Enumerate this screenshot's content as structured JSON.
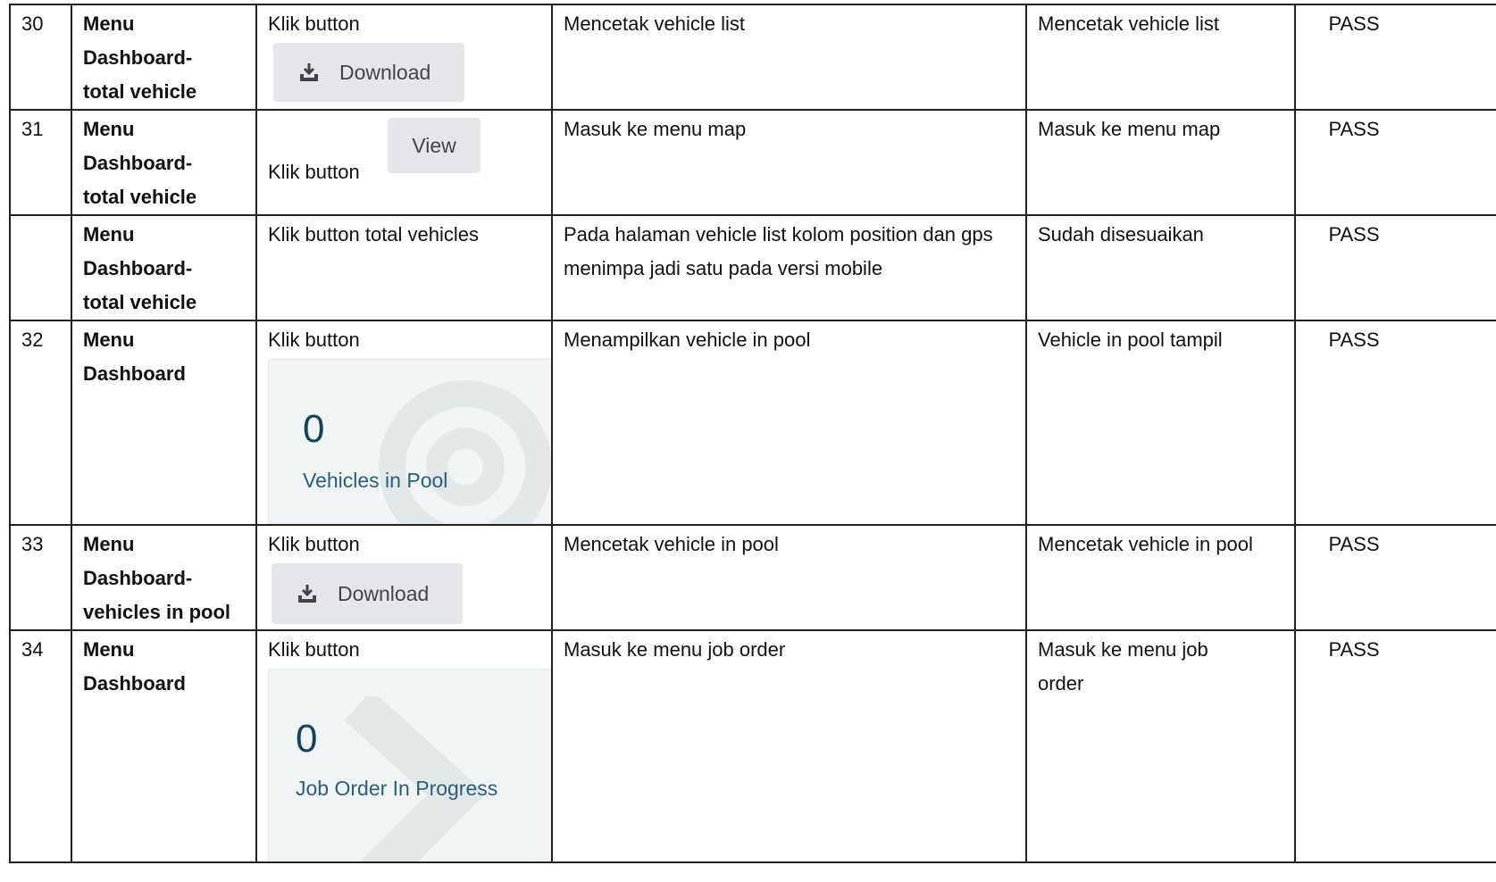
{
  "rows": [
    {
      "no": "30",
      "menu": [
        "Menu",
        "Dashboard-",
        "total vehicle"
      ],
      "step": "Klik button",
      "widget": {
        "type": "button",
        "label": "Download",
        "icon": "download-icon"
      },
      "expected": "Mencetak vehicle list",
      "actual": "Mencetak vehicle list",
      "status": "PASS"
    },
    {
      "no": "31",
      "menu": [
        "Menu",
        "Dashboard-",
        "total vehicle"
      ],
      "step": "Klik button",
      "widget": {
        "type": "button",
        "label": "View"
      },
      "expected": "Masuk ke menu map",
      "actual": "Masuk ke menu map",
      "status": "PASS"
    },
    {
      "no": "",
      "menu": [
        "Menu",
        "Dashboard-",
        "total vehicle"
      ],
      "step": "Klik button total vehicles",
      "expected": "Pada halaman vehicle list kolom position dan gps menimpa jadi satu pada versi mobile",
      "actual": "Sudah disesuaikan",
      "status": "PASS"
    },
    {
      "no": "32",
      "menu": [
        "Menu",
        "Dashboard"
      ],
      "step": "Klik button",
      "widget": {
        "type": "card",
        "count": "0",
        "label": "Vehicles in Pool"
      },
      "expected": "Menampilkan vehicle in pool",
      "actual": "Vehicle in pool tampil",
      "status": "PASS"
    },
    {
      "no": "33",
      "menu": [
        "Menu",
        "Dashboard-",
        "vehicles in pool"
      ],
      "step": "Klik button",
      "widget": {
        "type": "button",
        "label": "Download",
        "icon": "download-icon"
      },
      "expected": "Mencetak vehicle in pool",
      "actual": "Mencetak vehicle in pool",
      "status": "PASS"
    },
    {
      "no": "34",
      "menu": [
        "Menu",
        "Dashboard"
      ],
      "step": "Klik button",
      "widget": {
        "type": "card",
        "count": "0",
        "label": "Job Order In Progress"
      },
      "expected": "Masuk ke menu job order",
      "actual": "Masuk ke menu job order",
      "status": "PASS"
    }
  ],
  "colors": {
    "button_bg": "#e4e6ea",
    "card_bg": "#f1f4f4",
    "card_count": "#16435a",
    "card_label": "#2a5f7a"
  }
}
